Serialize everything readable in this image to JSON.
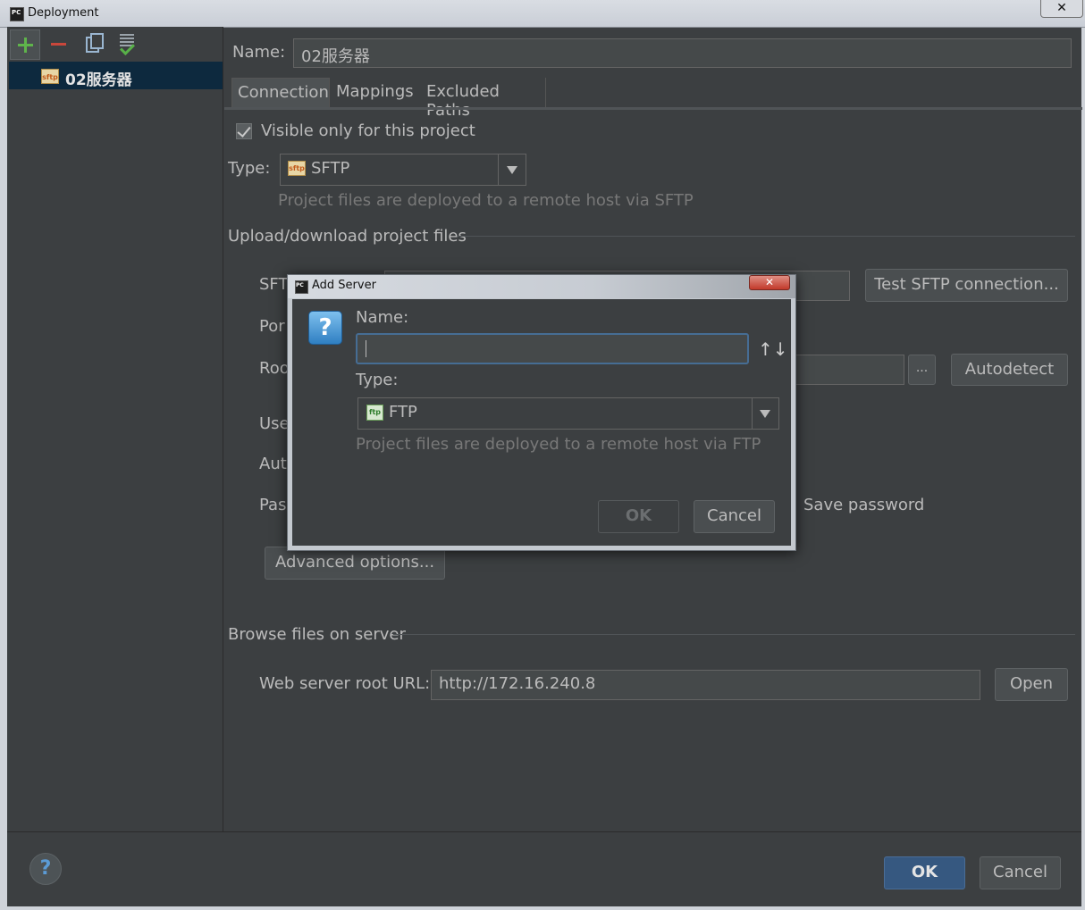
{
  "window": {
    "title": "Deployment",
    "close_glyph": "✕"
  },
  "toolbar": {
    "add": "add-icon",
    "remove": "remove-icon",
    "copy": "copy-icon",
    "use_default": "use-as-default-icon"
  },
  "server_list": {
    "items": [
      {
        "icon": "sftp-icon",
        "icon_text": "sftp",
        "label": "02服务器"
      }
    ]
  },
  "main": {
    "name_label": "Name:",
    "name_value": "02服务器",
    "tabs": [
      {
        "label": "Connection"
      },
      {
        "label": "Mappings"
      },
      {
        "label": "Excluded Paths"
      }
    ],
    "active_tab": "Connection",
    "visible_only_label": "Visible only for this project",
    "visible_only_checked": true,
    "type_label": "Type:",
    "type_value": "SFTP",
    "type_icon_text": "sftp",
    "type_hint": "Project files are deployed to a remote host via SFTP",
    "upload_heading": "Upload/download project files",
    "partial_labels": {
      "sftp_host": "SFT",
      "port": "Por",
      "root_path": "Roo",
      "user_name": "Use",
      "auth": "Aut",
      "password": "Pas"
    },
    "test_button": "Test SFTP connection...",
    "browse_button": "...",
    "autodetect_button": "Autodetect",
    "save_password_label": "Save password",
    "advanced_button": "Advanced options...",
    "browse_heading": "Browse files on server",
    "web_root_label": "Web server root URL:",
    "web_root_value": "http://172.16.240.8",
    "open_button": "Open"
  },
  "footer": {
    "help": "?",
    "ok": "OK",
    "cancel": "Cancel"
  },
  "dialog": {
    "title": "Add Server",
    "close_glyph": "✕",
    "question_glyph": "?",
    "name_label": "Name:",
    "name_value": "",
    "sort_glyph": "↑↓",
    "type_label": "Type:",
    "type_value": "FTP",
    "type_icon_text": "ftp",
    "type_hint": "Project files are deployed to a remote host via FTP",
    "ok": "OK",
    "cancel": "Cancel"
  }
}
